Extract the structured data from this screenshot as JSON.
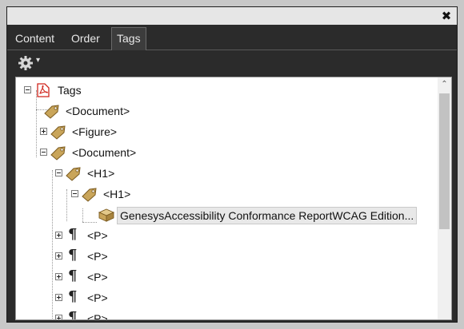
{
  "window": {
    "close_glyph": "✖"
  },
  "tabs": [
    {
      "label": "Content"
    },
    {
      "label": "Order"
    },
    {
      "label": "Tags"
    }
  ],
  "toolbar": {
    "options_icon": "gear-icon",
    "caret": "▾"
  },
  "tree": {
    "root": {
      "label": "Tags",
      "icon": "pdf-icon"
    },
    "nodes": [
      {
        "label": "<Document>"
      },
      {
        "label": "<Figure>"
      },
      {
        "label": "<Document>"
      },
      {
        "label": "<H1>"
      },
      {
        "label": "<H1>"
      },
      {
        "label": "GenesysAccessibility Conformance ReportWCAG Edition..."
      },
      {
        "label": "<P>"
      },
      {
        "label": "<P>"
      },
      {
        "label": "<P>"
      },
      {
        "label": "<P>"
      },
      {
        "label": "<P>"
      }
    ]
  },
  "scrollbar": {
    "up_glyph": "⌃"
  },
  "colors": {
    "panel": "#2b2b2b",
    "tag_gold": "#c9a55a",
    "pdf_red": "#d0251c"
  }
}
